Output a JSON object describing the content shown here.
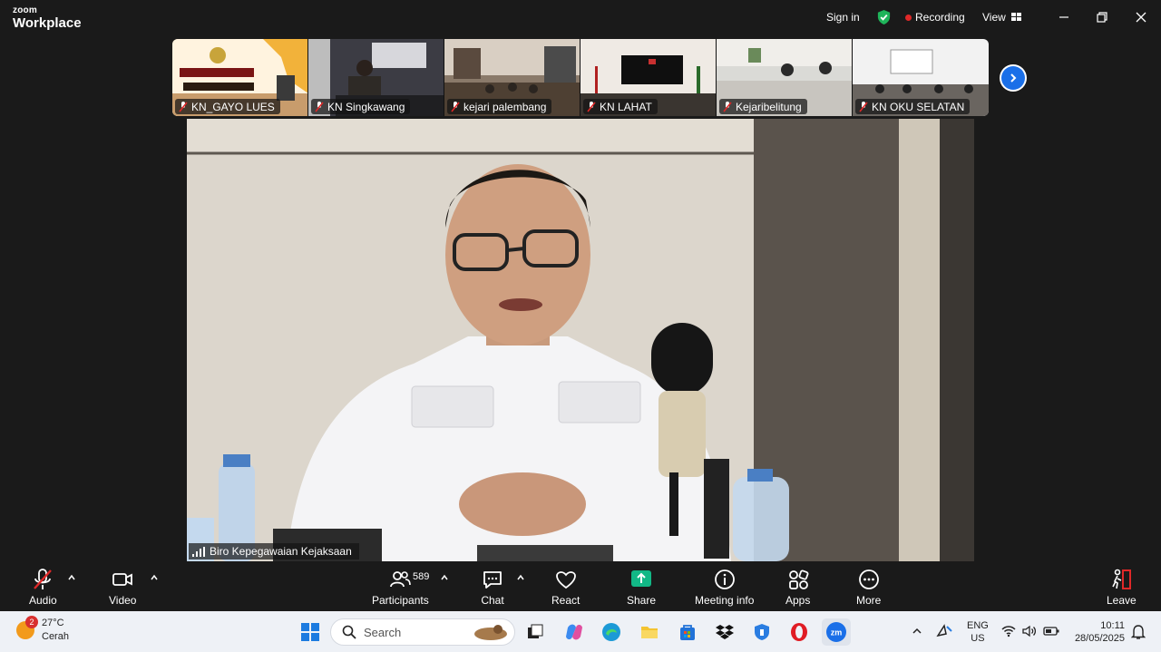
{
  "app": {
    "brand_top": "zoom",
    "brand_bottom": "Workplace"
  },
  "titlebar": {
    "sign_in": "Sign in",
    "recording": "Recording",
    "view": "View"
  },
  "thumbnails": [
    {
      "name": "KN_GAYO LUES",
      "muted": true
    },
    {
      "name": "KN Singkawang",
      "muted": true
    },
    {
      "name": "kejari palembang",
      "muted": true
    },
    {
      "name": "KN LAHAT",
      "muted": true
    },
    {
      "name": "Kejaribelitung",
      "muted": true
    },
    {
      "name": "KN OKU SELATAN",
      "muted": true
    }
  ],
  "main_video": {
    "speaker_name": "Biro Kepegawaian Kejaksaan"
  },
  "toolbar": {
    "audio": "Audio",
    "video": "Video",
    "participants": "Participants",
    "participants_count": "589",
    "chat": "Chat",
    "react": "React",
    "share": "Share",
    "meeting_info": "Meeting info",
    "apps": "Apps",
    "more": "More",
    "leave": "Leave"
  },
  "taskbar": {
    "weather_badge": "2",
    "temperature": "27°C",
    "condition": "Cerah",
    "search_placeholder": "Search",
    "lang_top": "ENG",
    "lang_bottom": "US",
    "time": "10:11",
    "date": "28/05/2025"
  },
  "colors": {
    "accent": "#1a6fe8",
    "record": "#e02828",
    "share": "#12b886",
    "mute": "#e02828"
  }
}
